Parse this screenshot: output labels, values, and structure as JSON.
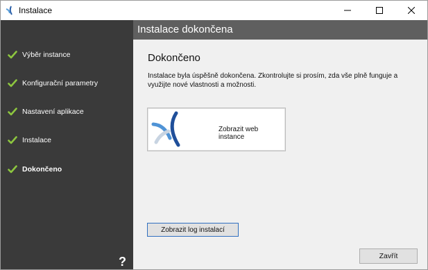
{
  "window": {
    "title": "Instalace",
    "minimize_icon": "minimize-icon",
    "maximize_icon": "maximize-icon",
    "close_icon": "close-icon"
  },
  "sidebar": {
    "steps": [
      {
        "label": "Výběr instance",
        "done": true,
        "active": false
      },
      {
        "label": "Konfigurační parametry",
        "done": true,
        "active": false
      },
      {
        "label": "Nastavení aplikace",
        "done": true,
        "active": false
      },
      {
        "label": "Instalace",
        "done": true,
        "active": false
      },
      {
        "label": "Dokončeno",
        "done": true,
        "active": true
      }
    ],
    "help_label": "?",
    "check_color": "#8dc63f"
  },
  "main": {
    "header_title": "Instalace dokončena",
    "section_title": "Dokončeno",
    "description": "Instalace byla úspěšně dokončena. Zkontrolujte si prosím, zda vše plně funguje a využijte nové vlastnosti a možnosti.",
    "web_card_label": "Zobrazit web instance",
    "log_button": "Zobrazit log instalací",
    "close_button": "Zavřít"
  }
}
